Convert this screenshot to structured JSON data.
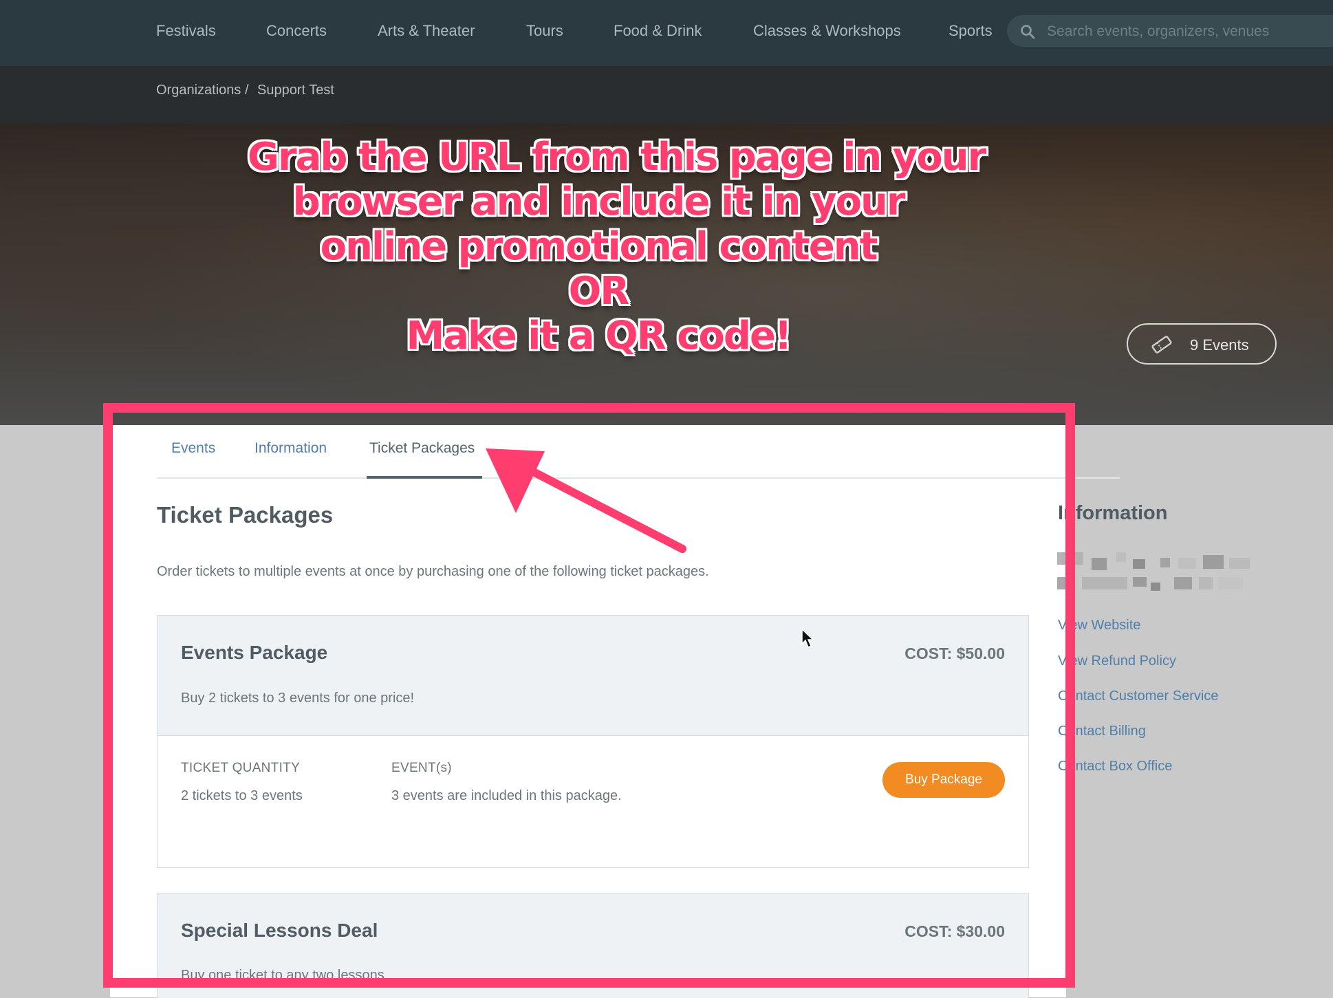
{
  "nav": {
    "items": [
      "Festivals",
      "Concerts",
      "Arts & Theater",
      "Tours",
      "Food & Drink",
      "Classes & Workshops",
      "Sports"
    ],
    "search_placeholder": "Search events, organizers, venues"
  },
  "breadcrumb": {
    "parent": "Organizations /",
    "current": "Support Test"
  },
  "hero": {
    "events_count_label": "9 Events"
  },
  "annotation": {
    "lines": [
      "Grab the URL from this page in your",
      "browser and include it in your",
      "online promotional content",
      "OR",
      "Make it a QR code!"
    ],
    "color": "#ff3d6e"
  },
  "tabs": [
    {
      "label": "Events",
      "active": false
    },
    {
      "label": "Information",
      "active": false
    },
    {
      "label": "Ticket Packages",
      "active": true
    }
  ],
  "section": {
    "title": "Ticket Packages",
    "description": "Order tickets to multiple events at once by purchasing one of the following ticket packages."
  },
  "packages": [
    {
      "name": "Events Package",
      "cost": "COST: $50.00",
      "description": "Buy 2 tickets to 3 events for one price!",
      "quantity_header": "TICKET QUANTITY",
      "quantity_value": "2 tickets to 3 events",
      "events_header": "EVENT(s)",
      "events_value": "3 events are included in this package.",
      "button": "Buy Package"
    },
    {
      "name": "Special Lessons Deal",
      "cost": "COST: $30.00",
      "description": "Buy one ticket to any two lessons"
    }
  ],
  "sidebar": {
    "title": "Information",
    "links": [
      "View Website",
      "View Refund Policy",
      "Contact Customer Service",
      "Contact Billing",
      "Contact Box Office"
    ]
  },
  "colors": {
    "nav_bg": "#2b3a41",
    "link": "#4f7fa8",
    "button": "#f28b22",
    "annotation": "#ff3d6e"
  }
}
